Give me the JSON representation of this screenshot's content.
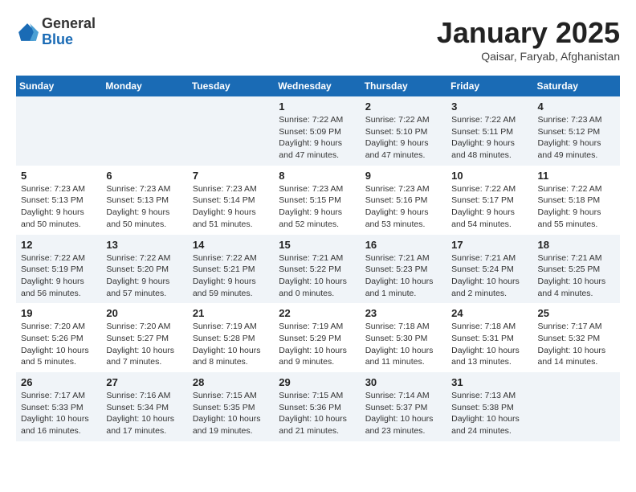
{
  "logo": {
    "general": "General",
    "blue": "Blue"
  },
  "header": {
    "title": "January 2025",
    "subtitle": "Qaisar, Faryab, Afghanistan"
  },
  "weekdays": [
    "Sunday",
    "Monday",
    "Tuesday",
    "Wednesday",
    "Thursday",
    "Friday",
    "Saturday"
  ],
  "weeks": [
    [
      {
        "day": "",
        "info": ""
      },
      {
        "day": "",
        "info": ""
      },
      {
        "day": "",
        "info": ""
      },
      {
        "day": "1",
        "info": "Sunrise: 7:22 AM\nSunset: 5:09 PM\nDaylight: 9 hours and 47 minutes."
      },
      {
        "day": "2",
        "info": "Sunrise: 7:22 AM\nSunset: 5:10 PM\nDaylight: 9 hours and 47 minutes."
      },
      {
        "day": "3",
        "info": "Sunrise: 7:22 AM\nSunset: 5:11 PM\nDaylight: 9 hours and 48 minutes."
      },
      {
        "day": "4",
        "info": "Sunrise: 7:23 AM\nSunset: 5:12 PM\nDaylight: 9 hours and 49 minutes."
      }
    ],
    [
      {
        "day": "5",
        "info": "Sunrise: 7:23 AM\nSunset: 5:13 PM\nDaylight: 9 hours and 50 minutes."
      },
      {
        "day": "6",
        "info": "Sunrise: 7:23 AM\nSunset: 5:13 PM\nDaylight: 9 hours and 50 minutes."
      },
      {
        "day": "7",
        "info": "Sunrise: 7:23 AM\nSunset: 5:14 PM\nDaylight: 9 hours and 51 minutes."
      },
      {
        "day": "8",
        "info": "Sunrise: 7:23 AM\nSunset: 5:15 PM\nDaylight: 9 hours and 52 minutes."
      },
      {
        "day": "9",
        "info": "Sunrise: 7:23 AM\nSunset: 5:16 PM\nDaylight: 9 hours and 53 minutes."
      },
      {
        "day": "10",
        "info": "Sunrise: 7:22 AM\nSunset: 5:17 PM\nDaylight: 9 hours and 54 minutes."
      },
      {
        "day": "11",
        "info": "Sunrise: 7:22 AM\nSunset: 5:18 PM\nDaylight: 9 hours and 55 minutes."
      }
    ],
    [
      {
        "day": "12",
        "info": "Sunrise: 7:22 AM\nSunset: 5:19 PM\nDaylight: 9 hours and 56 minutes."
      },
      {
        "day": "13",
        "info": "Sunrise: 7:22 AM\nSunset: 5:20 PM\nDaylight: 9 hours and 57 minutes."
      },
      {
        "day": "14",
        "info": "Sunrise: 7:22 AM\nSunset: 5:21 PM\nDaylight: 9 hours and 59 minutes."
      },
      {
        "day": "15",
        "info": "Sunrise: 7:21 AM\nSunset: 5:22 PM\nDaylight: 10 hours and 0 minutes."
      },
      {
        "day": "16",
        "info": "Sunrise: 7:21 AM\nSunset: 5:23 PM\nDaylight: 10 hours and 1 minute."
      },
      {
        "day": "17",
        "info": "Sunrise: 7:21 AM\nSunset: 5:24 PM\nDaylight: 10 hours and 2 minutes."
      },
      {
        "day": "18",
        "info": "Sunrise: 7:21 AM\nSunset: 5:25 PM\nDaylight: 10 hours and 4 minutes."
      }
    ],
    [
      {
        "day": "19",
        "info": "Sunrise: 7:20 AM\nSunset: 5:26 PM\nDaylight: 10 hours and 5 minutes."
      },
      {
        "day": "20",
        "info": "Sunrise: 7:20 AM\nSunset: 5:27 PM\nDaylight: 10 hours and 7 minutes."
      },
      {
        "day": "21",
        "info": "Sunrise: 7:19 AM\nSunset: 5:28 PM\nDaylight: 10 hours and 8 minutes."
      },
      {
        "day": "22",
        "info": "Sunrise: 7:19 AM\nSunset: 5:29 PM\nDaylight: 10 hours and 9 minutes."
      },
      {
        "day": "23",
        "info": "Sunrise: 7:18 AM\nSunset: 5:30 PM\nDaylight: 10 hours and 11 minutes."
      },
      {
        "day": "24",
        "info": "Sunrise: 7:18 AM\nSunset: 5:31 PM\nDaylight: 10 hours and 13 minutes."
      },
      {
        "day": "25",
        "info": "Sunrise: 7:17 AM\nSunset: 5:32 PM\nDaylight: 10 hours and 14 minutes."
      }
    ],
    [
      {
        "day": "26",
        "info": "Sunrise: 7:17 AM\nSunset: 5:33 PM\nDaylight: 10 hours and 16 minutes."
      },
      {
        "day": "27",
        "info": "Sunrise: 7:16 AM\nSunset: 5:34 PM\nDaylight: 10 hours and 17 minutes."
      },
      {
        "day": "28",
        "info": "Sunrise: 7:15 AM\nSunset: 5:35 PM\nDaylight: 10 hours and 19 minutes."
      },
      {
        "day": "29",
        "info": "Sunrise: 7:15 AM\nSunset: 5:36 PM\nDaylight: 10 hours and 21 minutes."
      },
      {
        "day": "30",
        "info": "Sunrise: 7:14 AM\nSunset: 5:37 PM\nDaylight: 10 hours and 23 minutes."
      },
      {
        "day": "31",
        "info": "Sunrise: 7:13 AM\nSunset: 5:38 PM\nDaylight: 10 hours and 24 minutes."
      },
      {
        "day": "",
        "info": ""
      }
    ]
  ]
}
